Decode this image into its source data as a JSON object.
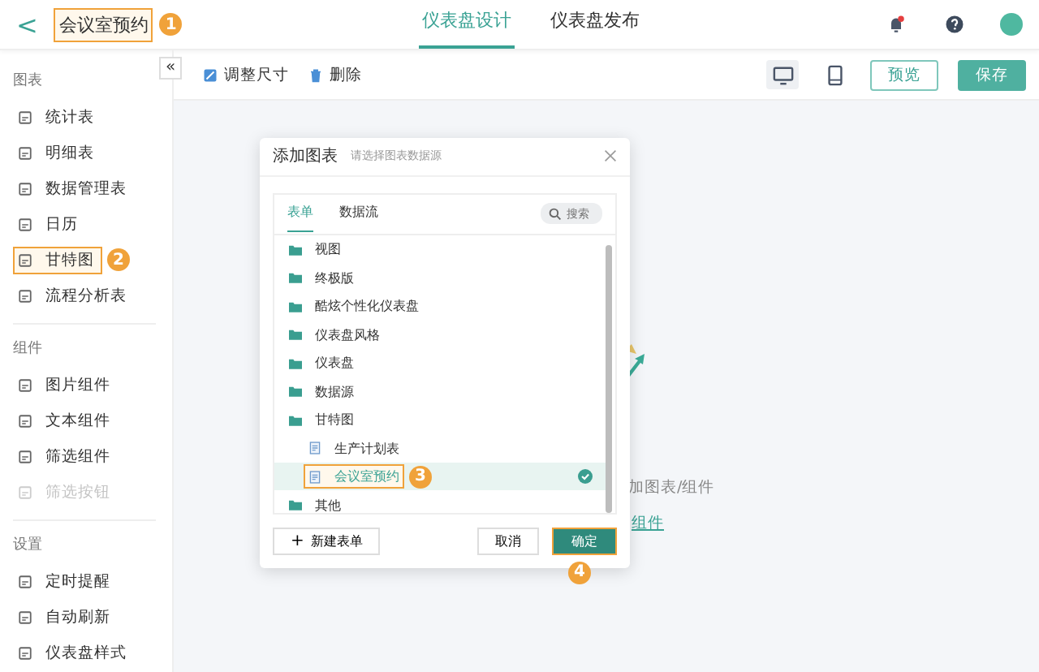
{
  "header": {
    "back": "<",
    "title": "会议室预约",
    "title_highlighted": true,
    "title_badge": "1",
    "tabs": [
      {
        "label": "仪表盘设计",
        "selected": true
      },
      {
        "label": "仪表盘发布",
        "selected": false
      }
    ],
    "has_notification": true
  },
  "toolbar": {
    "actions": [
      "调整尺寸",
      "删除"
    ],
    "devices": [
      {
        "kind": "desktop",
        "selected": true
      },
      {
        "kind": "tablet",
        "selected": false
      }
    ],
    "preview": "预览",
    "save": "保存"
  },
  "sidebar": {
    "collapse": "«",
    "sections": [
      {
        "title": "图表",
        "items": [
          {
            "label": "统计表",
            "disabled": false,
            "highlighted": false
          },
          {
            "label": "明细表",
            "disabled": false,
            "highlighted": false
          },
          {
            "label": "数据管理表",
            "disabled": false,
            "highlighted": false
          },
          {
            "label": "日历",
            "disabled": false,
            "highlighted": false
          },
          {
            "label": "甘特图",
            "disabled": false,
            "highlighted": true,
            "badge": "2"
          },
          {
            "label": "流程分析表",
            "disabled": false,
            "highlighted": false
          }
        ]
      },
      {
        "title": "组件",
        "items": [
          {
            "label": "图片组件",
            "disabled": false,
            "highlighted": false
          },
          {
            "label": "文本组件",
            "disabled": false,
            "highlighted": false
          },
          {
            "label": "筛选组件",
            "disabled": false,
            "highlighted": false
          },
          {
            "label": "筛选按钮",
            "disabled": true,
            "highlighted": false
          }
        ]
      },
      {
        "title": "设置",
        "items": [
          {
            "label": "定时提醒",
            "disabled": false,
            "highlighted": false
          },
          {
            "label": "自动刷新",
            "disabled": false,
            "highlighted": false
          },
          {
            "label": "仪表盘样式",
            "disabled": false,
            "highlighted": false
          }
        ]
      }
    ]
  },
  "canvas": {
    "hint": "加图表/组件",
    "link": "组件"
  },
  "dialog": {
    "title": "添加图表",
    "subtitle": "请选择图表数据源",
    "tabs": [
      {
        "label": "表单",
        "selected": true
      },
      {
        "label": "数据流",
        "selected": false
      }
    ],
    "search": {
      "placeholder": "搜索"
    },
    "tree": [
      {
        "label": "视图",
        "kind": "folder",
        "selected": false
      },
      {
        "label": "终极版",
        "kind": "folder",
        "selected": false
      },
      {
        "label": "酷炫个性化仪表盘",
        "kind": "folder",
        "selected": false
      },
      {
        "label": "仪表盘风格",
        "kind": "folder",
        "selected": false
      },
      {
        "label": "仪表盘",
        "kind": "folder",
        "selected": false
      },
      {
        "label": "数据源",
        "kind": "folder",
        "selected": false
      },
      {
        "label": "甘特图",
        "kind": "folder",
        "selected": false,
        "children": [
          {
            "label": "生产计划表",
            "kind": "form",
            "selected": false
          },
          {
            "label": "会议室预约",
            "kind": "form",
            "selected": true,
            "highlighted": true,
            "badge": "3"
          }
        ]
      },
      {
        "label": "其他",
        "kind": "folder",
        "selected": false
      }
    ],
    "new_form": "新建表单",
    "new_icon": "+",
    "cancel": "取消",
    "confirm": "确定",
    "confirm_highlighted": true,
    "confirm_badge": "4"
  }
}
